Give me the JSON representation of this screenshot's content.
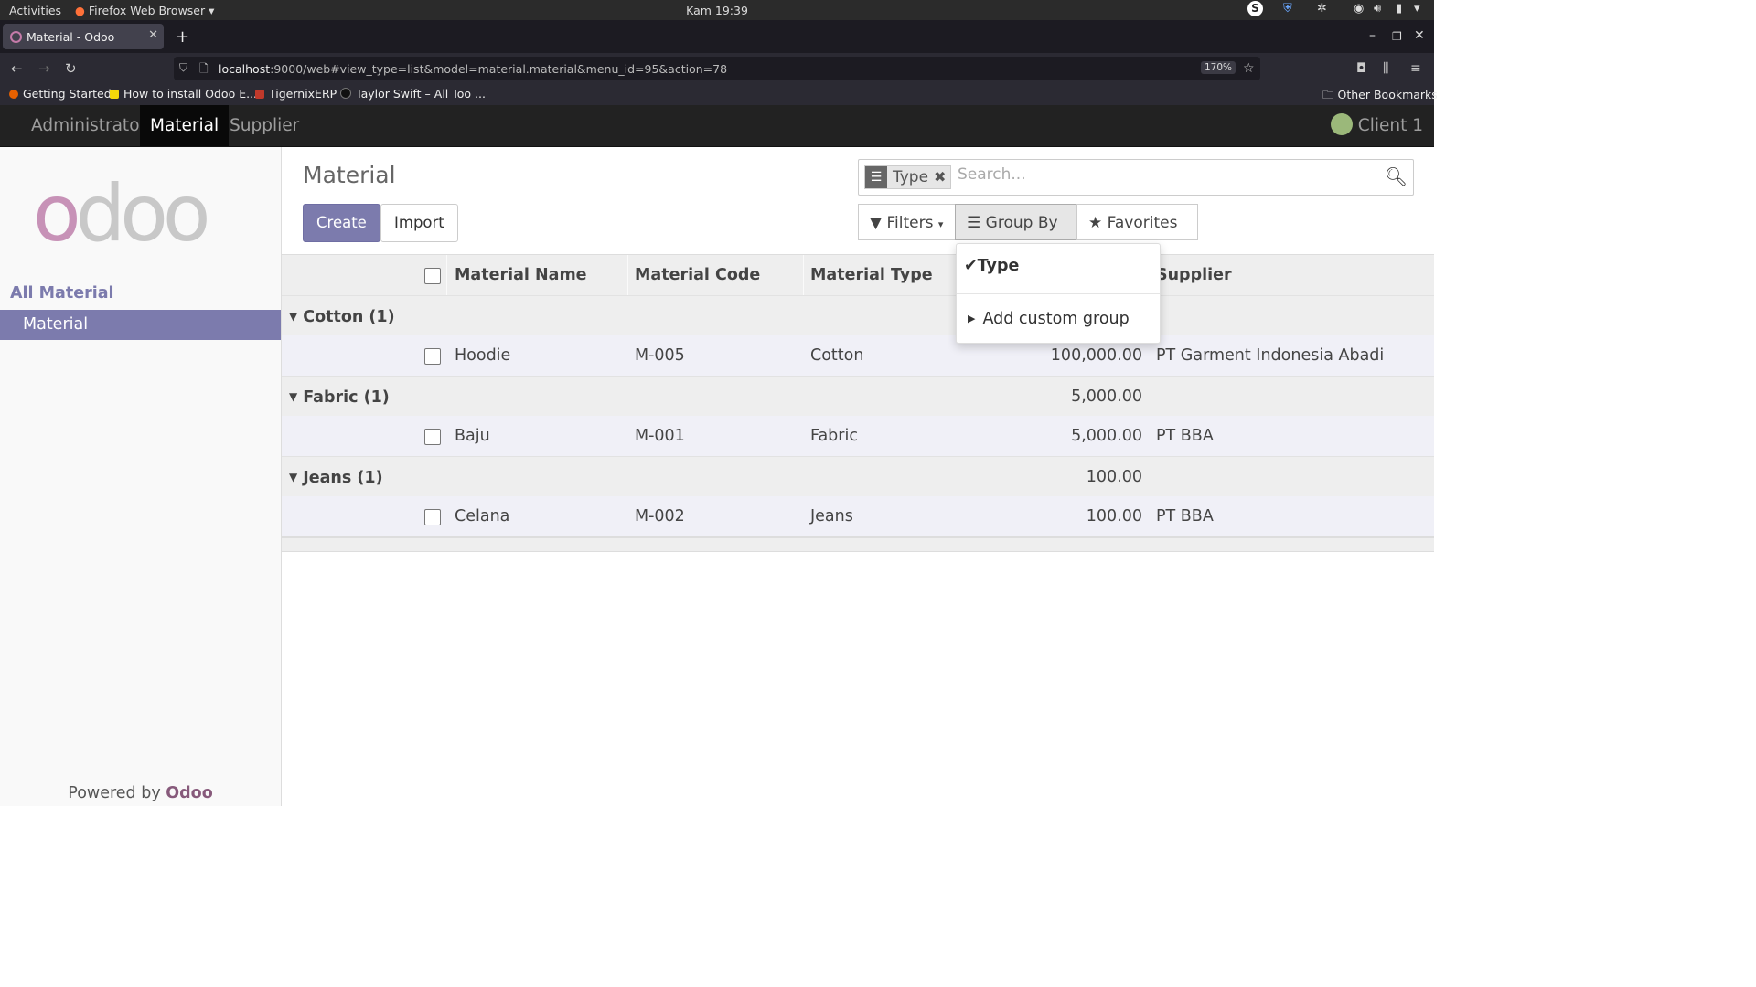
{
  "gnome": {
    "activities": "Activities",
    "app_menu": "Firefox Web Browser",
    "clock": "Kam 19:39"
  },
  "browser": {
    "tab_title": "Material - Odoo",
    "url_host": "localhost",
    "url_rest": ":9000/web#view_type=list&model=material.material&menu_id=95&action=78",
    "zoom": "170%",
    "bookmarks": [
      {
        "label": "Getting Started",
        "color": "#e66000"
      },
      {
        "label": "How to install Odoo E...",
        "color": "#f5d90a"
      },
      {
        "label": "TigernixERP",
        "color": "#c0392b"
      },
      {
        "label": "Taylor Swift – All Too ...",
        "color": "#222222"
      }
    ],
    "other_bookmarks": "Other Bookmarks"
  },
  "odoo_nav": {
    "items": [
      "Administrator",
      "Material",
      "Supplier"
    ],
    "active": "Material",
    "user": "Client 1"
  },
  "sidebar": {
    "logo": "odoo",
    "section": "All Material",
    "item": "Material",
    "powered_prefix": "Powered by",
    "powered_brand": "Odoo"
  },
  "control": {
    "title": "Material",
    "facet": "Type",
    "search_placeholder": "Search...",
    "create": "Create",
    "import": "Import",
    "filters": "Filters",
    "group_by": "Group By",
    "favorites": "Favorites"
  },
  "dropdown": {
    "selected": "Type",
    "custom": "Add custom group"
  },
  "table": {
    "columns": [
      "Material Name",
      "Material Code",
      "Material Type",
      "Supplier"
    ],
    "groups": [
      {
        "label": "Cotton (1)",
        "total": "",
        "row": {
          "name": "Hoodie",
          "code": "M-005",
          "type": "Cotton",
          "price": "100,000.00",
          "supplier": "PT Garment Indonesia Abadi"
        }
      },
      {
        "label": "Fabric (1)",
        "total": "5,000.00",
        "row": {
          "name": "Baju",
          "code": "M-001",
          "type": "Fabric",
          "price": "5,000.00",
          "supplier": "PT BBA"
        }
      },
      {
        "label": "Jeans (1)",
        "total": "100.00",
        "row": {
          "name": "Celana",
          "code": "M-002",
          "type": "Jeans",
          "price": "100.00",
          "supplier": "PT BBA"
        }
      }
    ]
  },
  "colors": {
    "accent": "#7c7bad",
    "brand": "#875a7b",
    "navbar": "#222222"
  }
}
